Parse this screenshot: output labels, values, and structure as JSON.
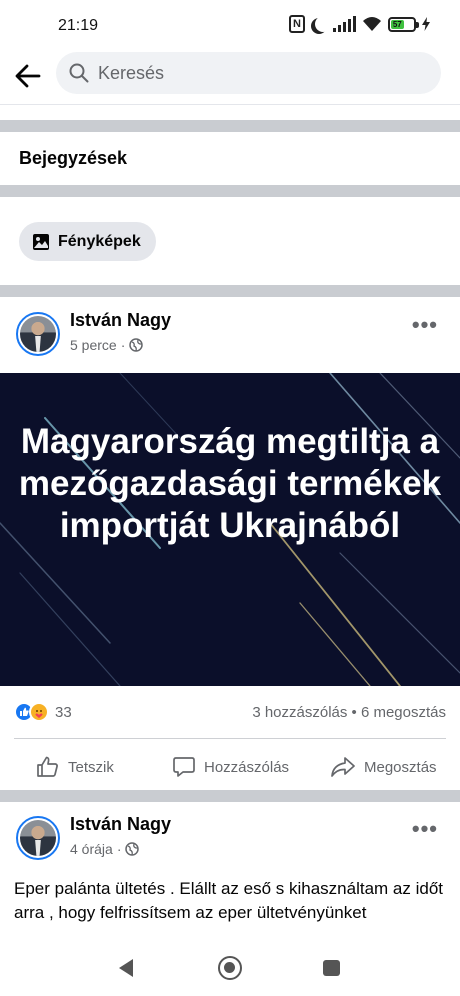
{
  "status": {
    "time": "21:19",
    "battery_level": "57",
    "nfc_label": "N"
  },
  "search": {
    "placeholder": "Keresés"
  },
  "section": {
    "title": "Bejegyzések"
  },
  "filter": {
    "chip_label": "Fényképek"
  },
  "posts": [
    {
      "author": "István Nagy",
      "time": "5 perce",
      "separator": "·",
      "image_headline": "Magyarország megtiltja a mezőgazdasági termékek importját Ukrajnából",
      "reaction_count": "33",
      "stats": "3 hozzászólás • 6 megosztás"
    },
    {
      "author": "István Nagy",
      "time": "4 órája",
      "separator": "·",
      "text": "Eper palánta ültetés . Elállt az eső s kihasználtam az időt arra , hogy felfrissítsem az eper ültetvényünket"
    }
  ],
  "actions": {
    "like": "Tetszik",
    "comment": "Hozzászólás",
    "share": "Megosztás"
  },
  "more_label": "•••",
  "colors": {
    "accent": "#1877f2",
    "separator": "#c9ccd1",
    "image_bg": "#0b0f2a"
  }
}
